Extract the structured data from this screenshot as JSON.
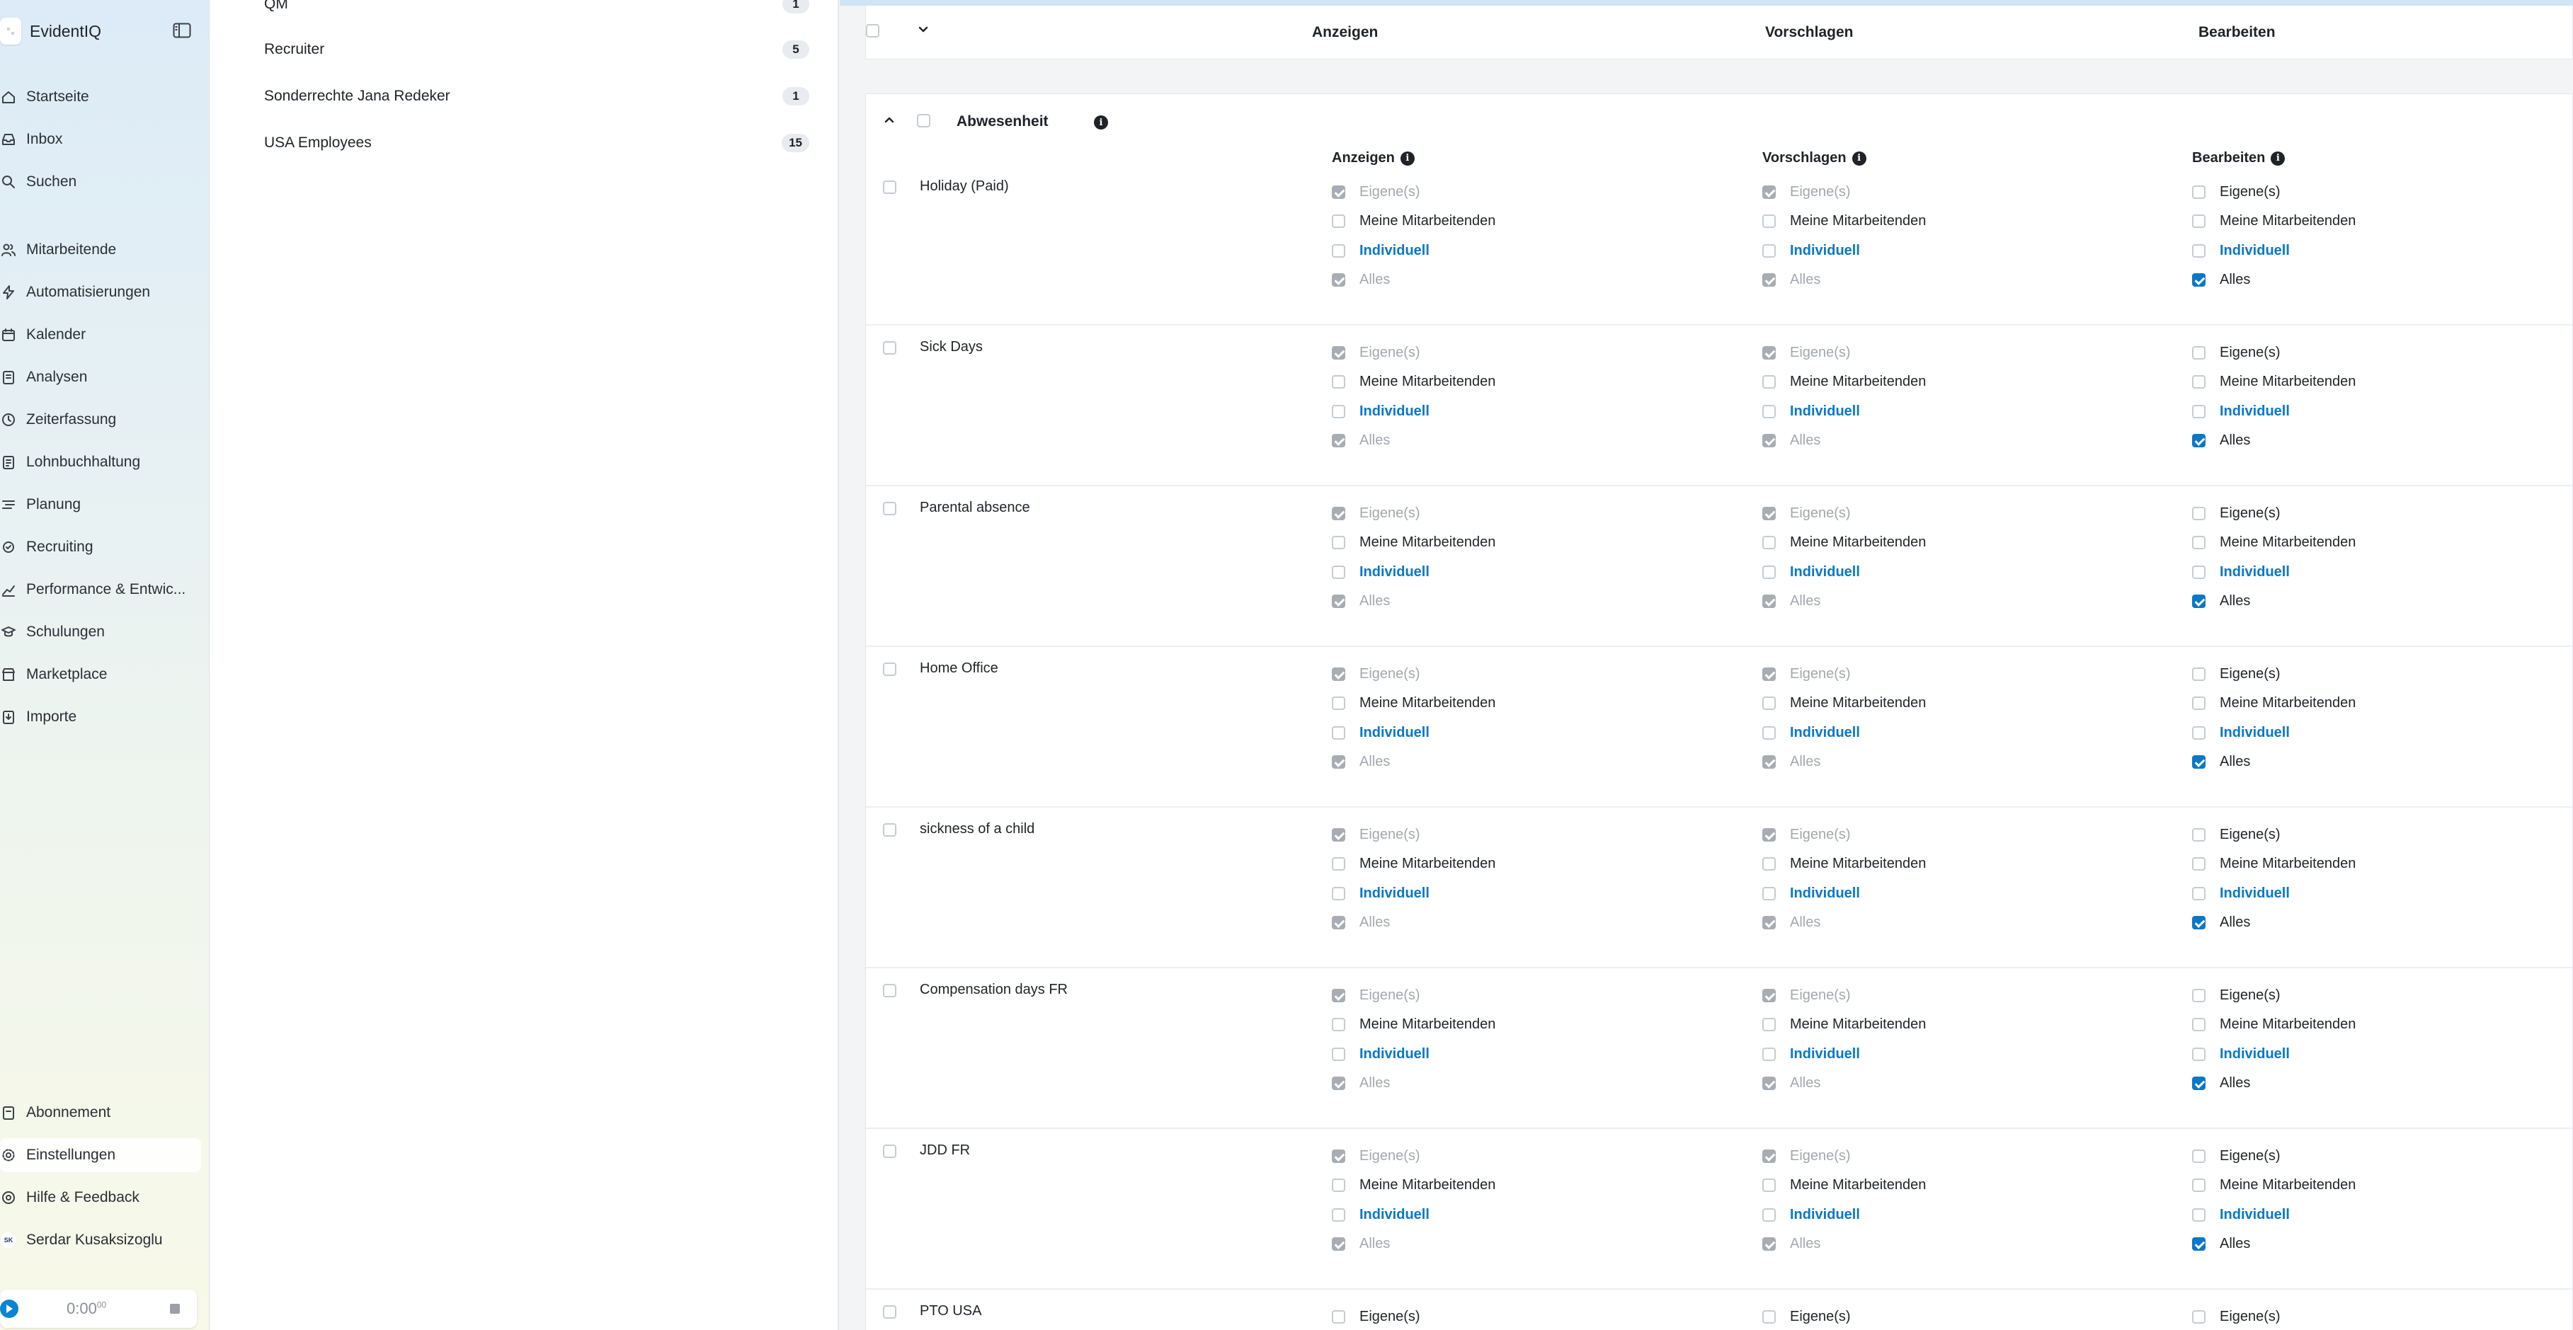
{
  "app": {
    "name": "EvidentIQ"
  },
  "nav": {
    "main": [
      {
        "label": "Startseite",
        "icon": "home-icon"
      },
      {
        "label": "Inbox",
        "icon": "inbox-icon"
      },
      {
        "label": "Suchen",
        "icon": "search-icon"
      }
    ],
    "modules": [
      {
        "label": "Mitarbeitende",
        "icon": "users-icon"
      },
      {
        "label": "Automatisierungen",
        "icon": "bolt-icon"
      },
      {
        "label": "Kalender",
        "icon": "calendar-icon"
      },
      {
        "label": "Analysen",
        "icon": "report-icon"
      },
      {
        "label": "Zeiterfassung",
        "icon": "clock-icon"
      },
      {
        "label": "Lohnbuchhaltung",
        "icon": "payroll-icon"
      },
      {
        "label": "Planung",
        "icon": "planning-icon"
      },
      {
        "label": "Recruiting",
        "icon": "recruiting-icon"
      },
      {
        "label": "Performance & Entwic...",
        "icon": "chart-line-icon"
      },
      {
        "label": "Schulungen",
        "icon": "training-icon"
      },
      {
        "label": "Marketplace",
        "icon": "marketplace-icon"
      },
      {
        "label": "Importe",
        "icon": "import-icon"
      }
    ],
    "bottom": [
      {
        "label": "Abonnement",
        "icon": "subscription-icon"
      },
      {
        "label": "Einstellungen",
        "icon": "gear-icon",
        "active": true
      },
      {
        "label": "Hilfe & Feedback",
        "icon": "help-icon"
      }
    ],
    "user": {
      "name": "Serdar Kusaksizoglu",
      "initials": "SK"
    }
  },
  "timer": {
    "time": "0:00",
    "seconds": "00"
  },
  "groups": [
    {
      "name": "QM",
      "count": "1"
    },
    {
      "name": "Recruiter",
      "count": "5"
    },
    {
      "name": "Sonderrechte Jana Redeker",
      "count": "1"
    },
    {
      "name": "USA Employees",
      "count": "15"
    }
  ],
  "permissions": {
    "header": {
      "show": "Anzeigen",
      "suggest": "Vorschlagen",
      "edit": "Bearbeiten"
    },
    "section": {
      "title": "Abwesenheit",
      "info": "i"
    },
    "options": {
      "own": "Eigene(s)",
      "team": "Meine Mitarbeitenden",
      "custom": "Individuell",
      "all": "Alles"
    },
    "rows": [
      {
        "label": "Holiday (Paid)"
      },
      {
        "label": "Sick Days"
      },
      {
        "label": "Parental absence"
      },
      {
        "label": "Home Office"
      },
      {
        "label": "sickness of a child"
      },
      {
        "label": "Compensation days FR"
      },
      {
        "label": "JDD FR"
      },
      {
        "label": "PTO USA"
      }
    ]
  }
}
